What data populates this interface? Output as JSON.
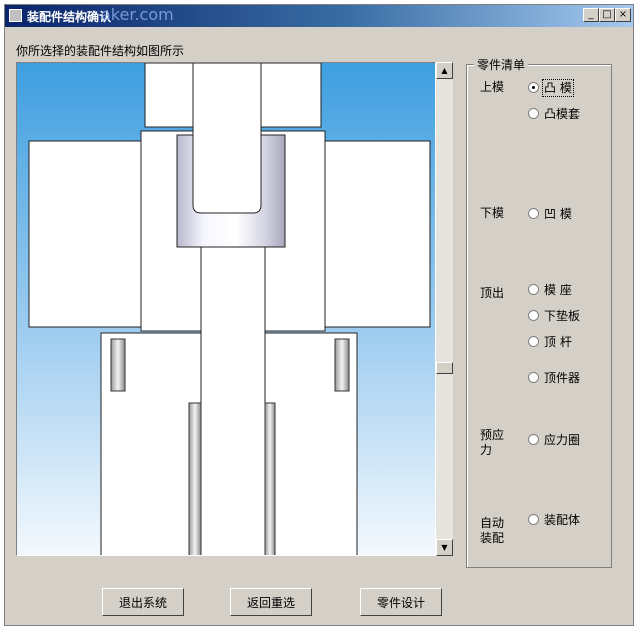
{
  "window": {
    "title": "装配件结构确认",
    "watermark": "aker.com",
    "controls": {
      "minimize": "_",
      "maximize": "□",
      "close": "×"
    }
  },
  "caption": "你所选择的装配件结构如图所示",
  "parts_list": {
    "legend": "零件清单",
    "groups": {
      "upper": "上模",
      "lower": "下模",
      "ejection": "顶出",
      "prestress": "预应力",
      "auto": "自动装配"
    },
    "options": {
      "punch": "凸 模",
      "punch_sleeve": "凸模套",
      "die": "凹 模",
      "die_seat": "模 座",
      "lower_pad": "下垫板",
      "ejector_pin": "顶 杆",
      "ejector": "顶件器",
      "stress_ring": "应力圈",
      "assembly": "装配体"
    },
    "selected": "punch"
  },
  "buttons": {
    "exit": "退出系统",
    "reselect": "返回重选",
    "part_design": "零件设计"
  },
  "scrollbar": {
    "up_icon": "▲",
    "down_icon": "▼"
  },
  "colors": {
    "titlebar_start": "#0a246a",
    "face": "#d4d0c8",
    "viewport_sky": "#3e9fe0"
  }
}
